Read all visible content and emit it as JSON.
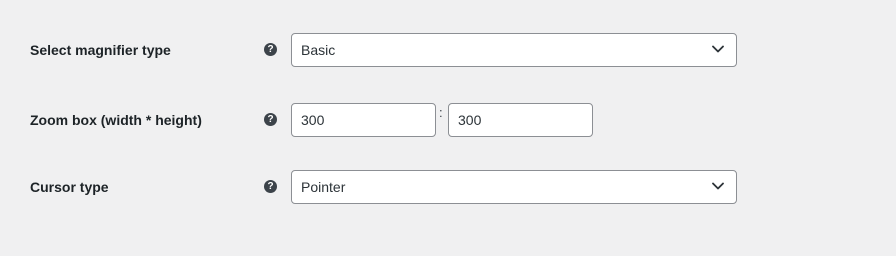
{
  "fields": {
    "magnifier_type": {
      "label": "Select magnifier type",
      "value": "Basic"
    },
    "zoom_box": {
      "label": "Zoom box (width * height)",
      "width": "300",
      "separator": ":",
      "height": "300"
    },
    "cursor_type": {
      "label": "Cursor type",
      "value": "Pointer"
    }
  },
  "help_glyph": "?",
  "icons": {
    "help": "question-circle-icon",
    "dropdown": "chevron-down-icon"
  },
  "colors": {
    "background": "#f0f0f1",
    "border": "#8c8f94",
    "help_icon": "#3c434a"
  }
}
